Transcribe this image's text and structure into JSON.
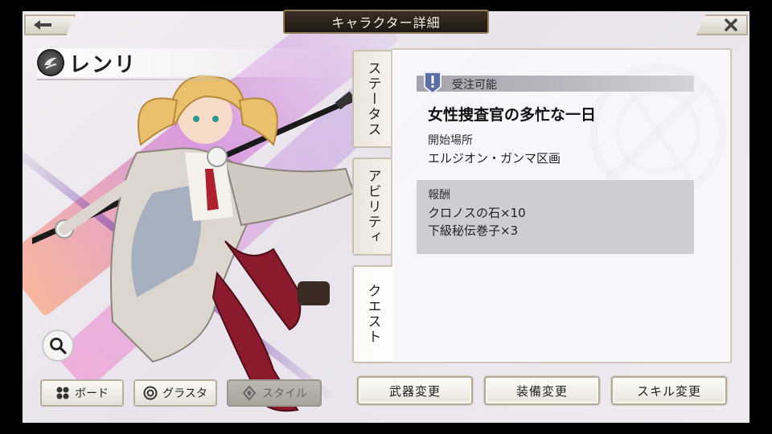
{
  "header": {
    "title": "キャラクター詳細",
    "back_icon": "left-arrow-icon",
    "close_icon": "close-icon"
  },
  "character": {
    "name": "レンリ",
    "attribute_icon": "wind-attribute-icon"
  },
  "tabs": [
    {
      "label": "ステータス",
      "active": false
    },
    {
      "label": "アビリティ",
      "active": false
    },
    {
      "label": "クエスト",
      "active": true
    }
  ],
  "quest": {
    "availability": "受注可能",
    "title": "女性捜査官の多忙な一日",
    "start_label": "開始場所",
    "start_value": "エルジオン・ガンマ区画",
    "reward_label": "報酬",
    "rewards": [
      "クロノスの石×10",
      "下級秘伝巻子×3"
    ]
  },
  "bottom_left": {
    "board": "ボード",
    "grasta": "グラスタ",
    "style": "スタイル"
  },
  "bottom_right": {
    "weapon_change": "武器変更",
    "equip_change": "装備変更",
    "skill_change": "スキル変更"
  },
  "colors": {
    "banner_bg": "#2a2119",
    "accent_purple": "#8a4fc7",
    "panel_border": "#cfc8bb"
  }
}
